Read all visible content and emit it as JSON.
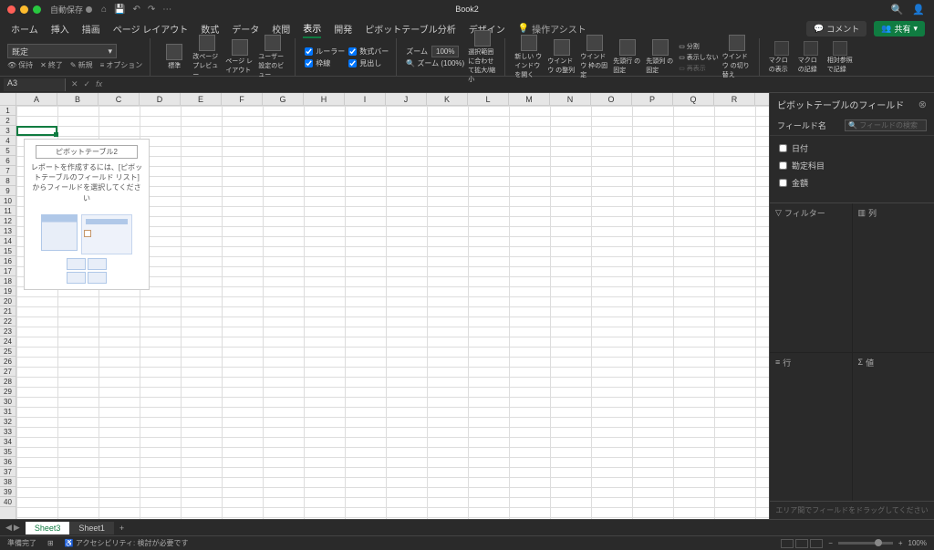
{
  "titlebar": {
    "autosave_label": "自動保存",
    "doc_title": "Book2"
  },
  "tabs": {
    "items": [
      "ホーム",
      "挿入",
      "描画",
      "ページ レイアウト",
      "数式",
      "データ",
      "校閲",
      "表示",
      "開発",
      "ピボットテーブル分析",
      "デザイン"
    ],
    "active_index": 7,
    "search_hint": "操作アシスト",
    "comment_btn": "コメント",
    "share_btn": "共有"
  },
  "ribbon": {
    "view_dropdown": "既定",
    "keep_btn": "保持",
    "exit_btn": "終了",
    "new_btn": "新規",
    "option_btn": "オプション",
    "views": {
      "normal": "標準",
      "page_break": "改ページ\nプレビュー",
      "page_layout": "ページ\nレイアウト",
      "custom": "ユーザー\n設定のビュー"
    },
    "show": {
      "ruler": "ルーラー",
      "formula_bar": "数式バー",
      "gridlines": "枠線",
      "headings": "見出し"
    },
    "zoom": {
      "label": "ズーム",
      "value": "100%",
      "zoom100": "ズーム (100%)",
      "selection": "選択範囲に合わせ\nて拡大/縮小"
    },
    "window": {
      "new_win": "新しい\nウインドウを開く",
      "arrange": "ウインドウ\nの整列",
      "freeze": "ウインドウ\n枠の固定",
      "first_row": "先頭行\nの固定",
      "first_col": "先頭列\nの固定",
      "split": "分割",
      "hide": "表示しない",
      "unhide": "再表示",
      "switch": "ウインドウ\nの切り替え"
    },
    "macro": {
      "show": "マクロ\nの表示",
      "record": "マクロ\nの記録",
      "relative": "相対参照\nで記録"
    }
  },
  "formula_bar": {
    "namebox": "A3"
  },
  "columns": [
    "A",
    "B",
    "C",
    "D",
    "E",
    "F",
    "G",
    "H",
    "I",
    "J",
    "K",
    "L",
    "M",
    "N",
    "O",
    "P",
    "Q",
    "R"
  ],
  "row_count": 40,
  "pivot_placeholder": {
    "title": "ピボットテーブル2",
    "text": "レポートを作成するには、[ピボットテーブルのフィールド リスト] からフィールドを選択してください"
  },
  "field_pane": {
    "title": "ピボットテーブルのフィールド",
    "field_name_label": "フィールド名",
    "search_placeholder": "フィールドの検索",
    "fields": [
      "日付",
      "勘定科目",
      "金額"
    ],
    "areas": {
      "filters": "フィルター",
      "columns": "列",
      "rows": "行",
      "values": "値"
    },
    "drag_hint": "エリア間でフィールドをドラッグしてください"
  },
  "sheet_tabs": {
    "tabs": [
      "Sheet3",
      "Sheet1"
    ],
    "active_index": 0
  },
  "status": {
    "ready": "準備完了",
    "accessibility": "アクセシビリティ: 検討が必要です",
    "zoom": "100%"
  }
}
